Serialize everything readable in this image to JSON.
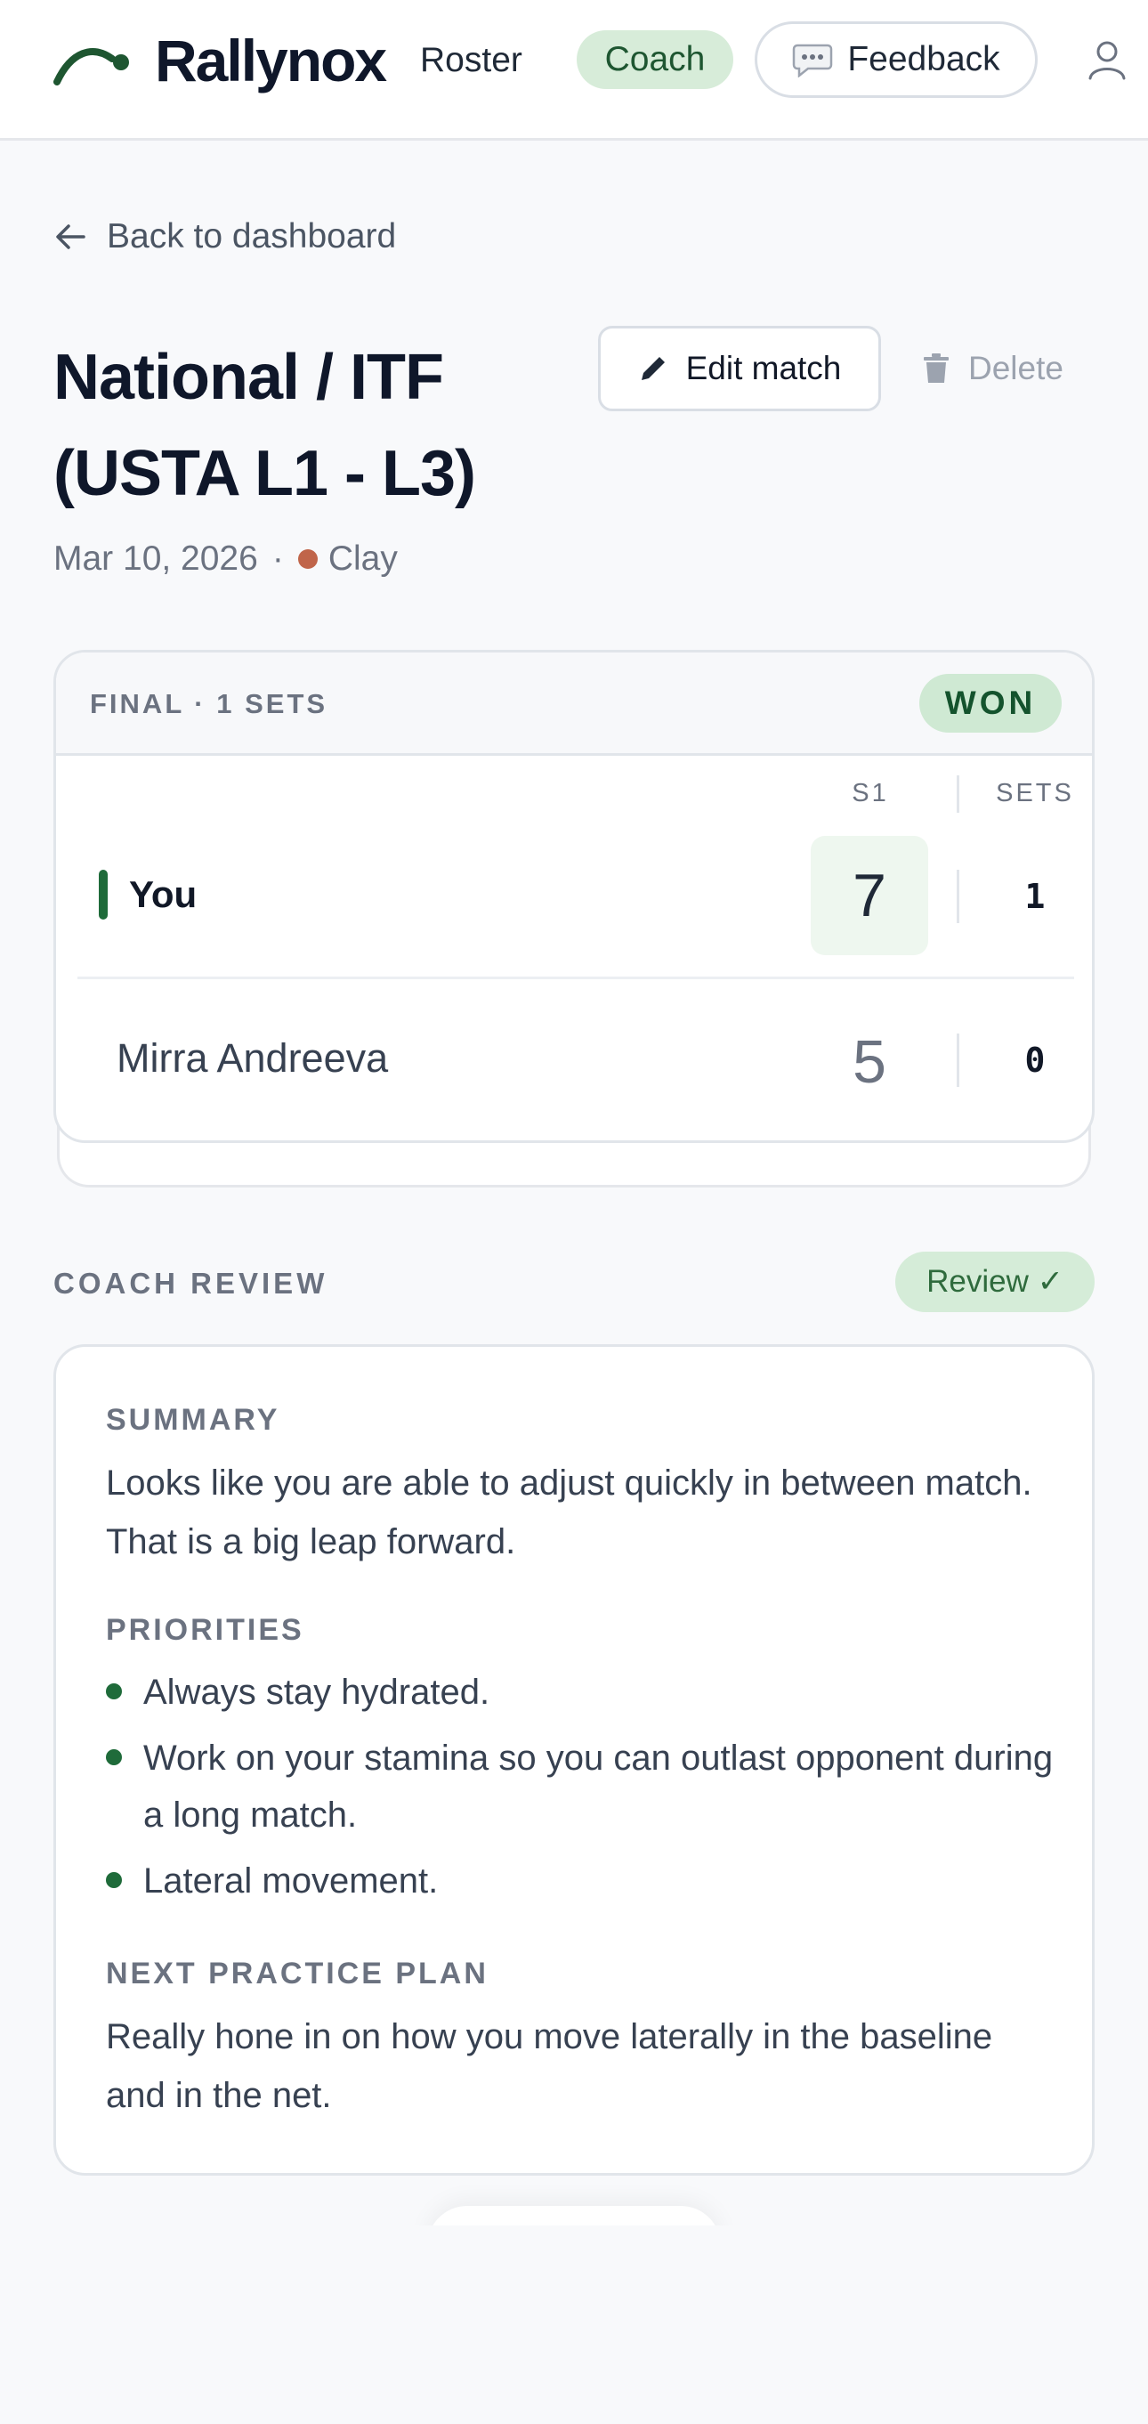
{
  "nav": {
    "brand": "Rallynox",
    "roster": "Roster",
    "coach": "Coach",
    "feedback": "Feedback",
    "logo_icon": "rally-swoosh-logo",
    "feedback_icon": "speech-bubble-icon",
    "user_icon": "user-icon"
  },
  "back_link": {
    "label": "Back to dashboard",
    "icon": "arrow-left-icon"
  },
  "match": {
    "title": "National / ITF (USTA L1 - L3)",
    "date": "Mar 10, 2026",
    "separator": "·",
    "surface": "Clay",
    "surface_color": "#c0654a",
    "edit_label": "Edit match",
    "delete_label": "Delete"
  },
  "score": {
    "header": "FINAL · 1 SETS",
    "result": "WON",
    "col_s1": "S1",
    "col_sets": "SETS",
    "players": [
      {
        "name": "You",
        "s1": "7",
        "sets": "1"
      },
      {
        "name": "Mirra Andreeva",
        "s1": "5",
        "sets": "0"
      }
    ]
  },
  "review": {
    "section_label": "COACH REVIEW",
    "badge": "Review ✓",
    "summary_label": "SUMMARY",
    "summary_text": "Looks like you are able to adjust quickly in between match. That is a big leap forward.",
    "priorities_label": "PRIORITIES",
    "priorities": [
      "Always stay hydrated.",
      "Work on your stamina so you can outlast opponent during a long match.",
      "Lateral movement."
    ],
    "plan_label": "NEXT PRACTICE PLAN",
    "plan_text": "Really hone in on how you move laterally in the baseline and in the net."
  },
  "colors": {
    "accent_green": "#1f6b3a",
    "badge_green_bg": "#d7ecd9",
    "page_bg": "#f8f9fb"
  }
}
